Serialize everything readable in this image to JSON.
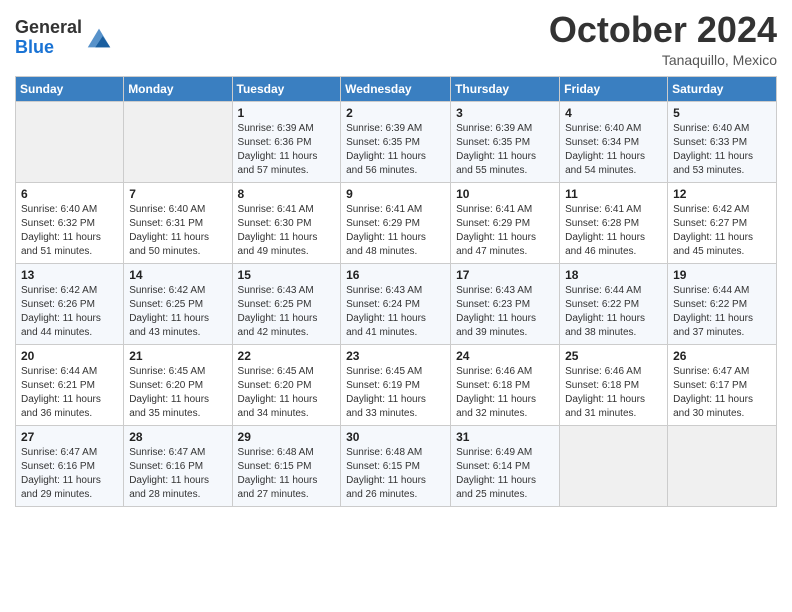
{
  "header": {
    "logo_line1": "General",
    "logo_line2": "Blue",
    "month": "October 2024",
    "location": "Tanaquillo, Mexico"
  },
  "weekdays": [
    "Sunday",
    "Monday",
    "Tuesday",
    "Wednesday",
    "Thursday",
    "Friday",
    "Saturday"
  ],
  "weeks": [
    [
      {
        "day": "",
        "sunrise": "",
        "sunset": "",
        "daylight": ""
      },
      {
        "day": "",
        "sunrise": "",
        "sunset": "",
        "daylight": ""
      },
      {
        "day": "1",
        "sunrise": "Sunrise: 6:39 AM",
        "sunset": "Sunset: 6:36 PM",
        "daylight": "Daylight: 11 hours and 57 minutes."
      },
      {
        "day": "2",
        "sunrise": "Sunrise: 6:39 AM",
        "sunset": "Sunset: 6:35 PM",
        "daylight": "Daylight: 11 hours and 56 minutes."
      },
      {
        "day": "3",
        "sunrise": "Sunrise: 6:39 AM",
        "sunset": "Sunset: 6:35 PM",
        "daylight": "Daylight: 11 hours and 55 minutes."
      },
      {
        "day": "4",
        "sunrise": "Sunrise: 6:40 AM",
        "sunset": "Sunset: 6:34 PM",
        "daylight": "Daylight: 11 hours and 54 minutes."
      },
      {
        "day": "5",
        "sunrise": "Sunrise: 6:40 AM",
        "sunset": "Sunset: 6:33 PM",
        "daylight": "Daylight: 11 hours and 53 minutes."
      }
    ],
    [
      {
        "day": "6",
        "sunrise": "Sunrise: 6:40 AM",
        "sunset": "Sunset: 6:32 PM",
        "daylight": "Daylight: 11 hours and 51 minutes."
      },
      {
        "day": "7",
        "sunrise": "Sunrise: 6:40 AM",
        "sunset": "Sunset: 6:31 PM",
        "daylight": "Daylight: 11 hours and 50 minutes."
      },
      {
        "day": "8",
        "sunrise": "Sunrise: 6:41 AM",
        "sunset": "Sunset: 6:30 PM",
        "daylight": "Daylight: 11 hours and 49 minutes."
      },
      {
        "day": "9",
        "sunrise": "Sunrise: 6:41 AM",
        "sunset": "Sunset: 6:29 PM",
        "daylight": "Daylight: 11 hours and 48 minutes."
      },
      {
        "day": "10",
        "sunrise": "Sunrise: 6:41 AM",
        "sunset": "Sunset: 6:29 PM",
        "daylight": "Daylight: 11 hours and 47 minutes."
      },
      {
        "day": "11",
        "sunrise": "Sunrise: 6:41 AM",
        "sunset": "Sunset: 6:28 PM",
        "daylight": "Daylight: 11 hours and 46 minutes."
      },
      {
        "day": "12",
        "sunrise": "Sunrise: 6:42 AM",
        "sunset": "Sunset: 6:27 PM",
        "daylight": "Daylight: 11 hours and 45 minutes."
      }
    ],
    [
      {
        "day": "13",
        "sunrise": "Sunrise: 6:42 AM",
        "sunset": "Sunset: 6:26 PM",
        "daylight": "Daylight: 11 hours and 44 minutes."
      },
      {
        "day": "14",
        "sunrise": "Sunrise: 6:42 AM",
        "sunset": "Sunset: 6:25 PM",
        "daylight": "Daylight: 11 hours and 43 minutes."
      },
      {
        "day": "15",
        "sunrise": "Sunrise: 6:43 AM",
        "sunset": "Sunset: 6:25 PM",
        "daylight": "Daylight: 11 hours and 42 minutes."
      },
      {
        "day": "16",
        "sunrise": "Sunrise: 6:43 AM",
        "sunset": "Sunset: 6:24 PM",
        "daylight": "Daylight: 11 hours and 41 minutes."
      },
      {
        "day": "17",
        "sunrise": "Sunrise: 6:43 AM",
        "sunset": "Sunset: 6:23 PM",
        "daylight": "Daylight: 11 hours and 39 minutes."
      },
      {
        "day": "18",
        "sunrise": "Sunrise: 6:44 AM",
        "sunset": "Sunset: 6:22 PM",
        "daylight": "Daylight: 11 hours and 38 minutes."
      },
      {
        "day": "19",
        "sunrise": "Sunrise: 6:44 AM",
        "sunset": "Sunset: 6:22 PM",
        "daylight": "Daylight: 11 hours and 37 minutes."
      }
    ],
    [
      {
        "day": "20",
        "sunrise": "Sunrise: 6:44 AM",
        "sunset": "Sunset: 6:21 PM",
        "daylight": "Daylight: 11 hours and 36 minutes."
      },
      {
        "day": "21",
        "sunrise": "Sunrise: 6:45 AM",
        "sunset": "Sunset: 6:20 PM",
        "daylight": "Daylight: 11 hours and 35 minutes."
      },
      {
        "day": "22",
        "sunrise": "Sunrise: 6:45 AM",
        "sunset": "Sunset: 6:20 PM",
        "daylight": "Daylight: 11 hours and 34 minutes."
      },
      {
        "day": "23",
        "sunrise": "Sunrise: 6:45 AM",
        "sunset": "Sunset: 6:19 PM",
        "daylight": "Daylight: 11 hours and 33 minutes."
      },
      {
        "day": "24",
        "sunrise": "Sunrise: 6:46 AM",
        "sunset": "Sunset: 6:18 PM",
        "daylight": "Daylight: 11 hours and 32 minutes."
      },
      {
        "day": "25",
        "sunrise": "Sunrise: 6:46 AM",
        "sunset": "Sunset: 6:18 PM",
        "daylight": "Daylight: 11 hours and 31 minutes."
      },
      {
        "day": "26",
        "sunrise": "Sunrise: 6:47 AM",
        "sunset": "Sunset: 6:17 PM",
        "daylight": "Daylight: 11 hours and 30 minutes."
      }
    ],
    [
      {
        "day": "27",
        "sunrise": "Sunrise: 6:47 AM",
        "sunset": "Sunset: 6:16 PM",
        "daylight": "Daylight: 11 hours and 29 minutes."
      },
      {
        "day": "28",
        "sunrise": "Sunrise: 6:47 AM",
        "sunset": "Sunset: 6:16 PM",
        "daylight": "Daylight: 11 hours and 28 minutes."
      },
      {
        "day": "29",
        "sunrise": "Sunrise: 6:48 AM",
        "sunset": "Sunset: 6:15 PM",
        "daylight": "Daylight: 11 hours and 27 minutes."
      },
      {
        "day": "30",
        "sunrise": "Sunrise: 6:48 AM",
        "sunset": "Sunset: 6:15 PM",
        "daylight": "Daylight: 11 hours and 26 minutes."
      },
      {
        "day": "31",
        "sunrise": "Sunrise: 6:49 AM",
        "sunset": "Sunset: 6:14 PM",
        "daylight": "Daylight: 11 hours and 25 minutes."
      },
      {
        "day": "",
        "sunrise": "",
        "sunset": "",
        "daylight": ""
      },
      {
        "day": "",
        "sunrise": "",
        "sunset": "",
        "daylight": ""
      }
    ]
  ]
}
